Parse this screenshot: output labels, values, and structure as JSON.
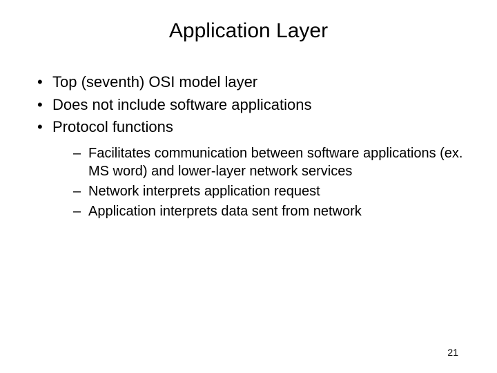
{
  "title": "Application Layer",
  "bullets": {
    "b1": "Top (seventh) OSI model layer",
    "b2": "Does not include software applications",
    "b3": "Protocol functions"
  },
  "subbullets": {
    "s1": "Facilitates communication between software applications (ex. MS word) and lower-layer network services",
    "s2": "Network interprets application request",
    "s3": "Application interprets data sent from network"
  },
  "page_number": "21"
}
